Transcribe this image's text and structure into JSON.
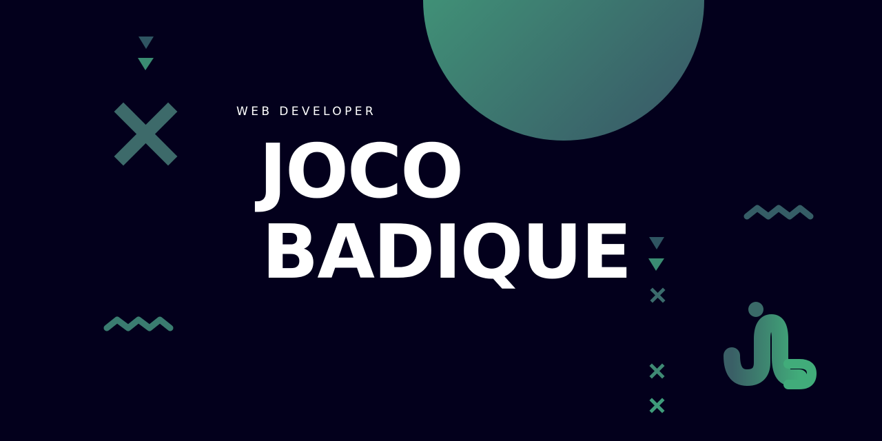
{
  "banner": {
    "subtitle": "WEB DEVELOPER",
    "name_line1": "JOCO",
    "name_line2": "BADIQUE"
  },
  "colors": {
    "background": "#03001c",
    "text": "#ffffff",
    "accent_green": "#3f9b7a",
    "accent_slate": "#3a5f66",
    "logo_gradient_start": "#3a5f66",
    "logo_gradient_end": "#41a879"
  },
  "icons": {
    "large_cross": "x-cross-icon",
    "triangles": "triangle-down-icon",
    "waves": "zigzag-wave-icon",
    "small_crosses": "small-x-icon",
    "circle": "gradient-circle",
    "logo": "jb-monogram-logo"
  }
}
